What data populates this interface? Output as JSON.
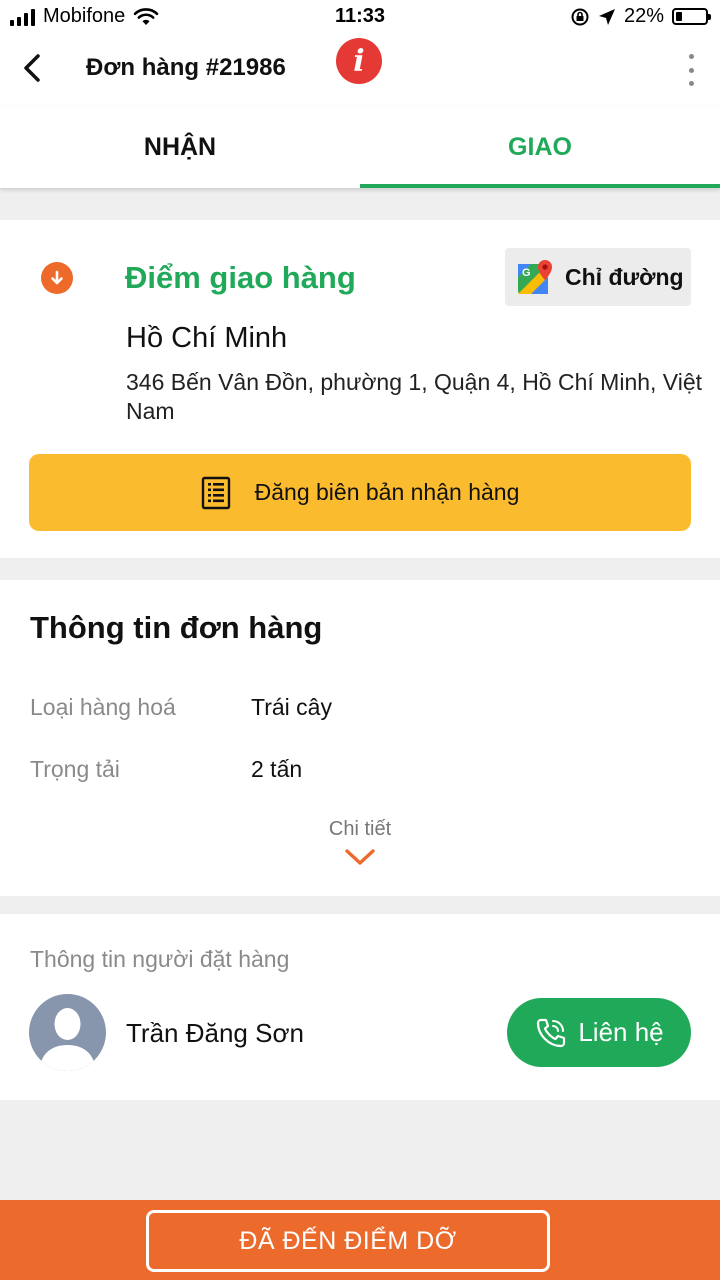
{
  "status_bar": {
    "carrier": "Mobifone",
    "time": "11:33",
    "battery_percent": "22%",
    "battery_level": 0.22
  },
  "header": {
    "order_title": "Đơn hàng #21986",
    "info_glyph": "i",
    "back_icon": "chevron-left-icon",
    "more_icon": "more-vertical-icon"
  },
  "tabs": [
    {
      "label": "NHẬN",
      "active": false
    },
    {
      "label": "GIAO",
      "active": true
    }
  ],
  "delivery_point": {
    "title": "Điểm giao hàng",
    "directions_label": "Chỉ đường",
    "city": "Hồ Chí Minh",
    "address": "346 Bến Vân Đồn, phường 1, Quận 4, Hồ Chí Minh, Việt Nam",
    "upload_label": "Đăng biên bản nhận hàng"
  },
  "order_info": {
    "heading": "Thông tin đơn hàng",
    "rows": [
      {
        "label": "Loại hàng hoá",
        "value": "Trái cây"
      },
      {
        "label": "Trọng tải",
        "value": "2 tấn"
      }
    ],
    "details_label": "Chi tiết"
  },
  "orderer": {
    "heading": "Thông tin người đặt hàng",
    "name": "Trần Đăng Sơn",
    "contact_label": "Liên hệ"
  },
  "footer": {
    "arrived_label": "ĐÃ ĐẾN ĐIỂM DỠ"
  },
  "colors": {
    "green": "#21a95a",
    "orange": "#ec6a2b",
    "yellow": "#fbbb2e",
    "red": "#e53935"
  }
}
